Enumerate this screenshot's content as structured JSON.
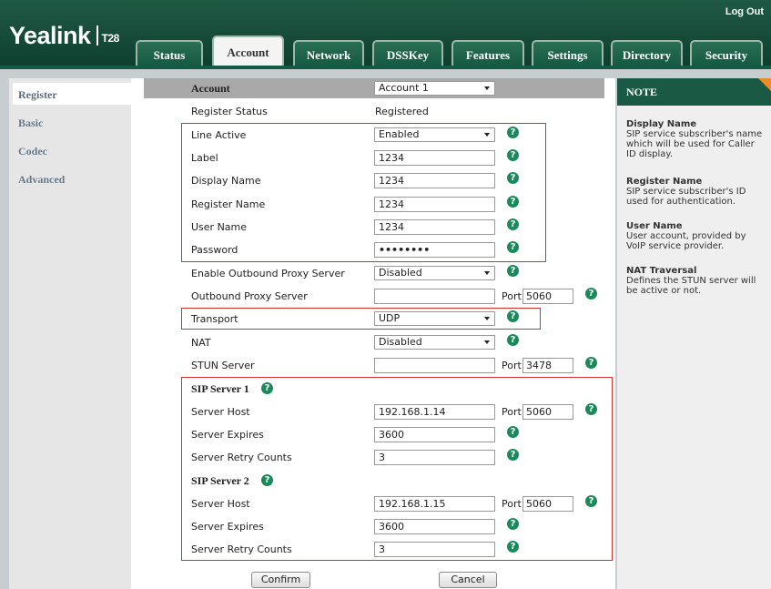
{
  "header": {
    "brand": "Yealink",
    "model": "T28",
    "logout": "Log Out",
    "tabs": [
      "Status",
      "Account",
      "Network",
      "DSSKey",
      "Features",
      "Settings",
      "Directory",
      "Security"
    ],
    "active_tab": "Account"
  },
  "sidebar": {
    "items": [
      "Register",
      "Basic",
      "Codec",
      "Advanced"
    ],
    "selected": "Register"
  },
  "form": {
    "account_label": "Account",
    "account_value": "Account 1",
    "register_status_label": "Register Status",
    "register_status_value": "Registered",
    "line_active_label": "Line Active",
    "line_active_value": "Enabled",
    "label_label": "Label",
    "label_value": "1234",
    "display_name_label": "Display Name",
    "display_name_value": "1234",
    "register_name_label": "Register Name",
    "register_name_value": "1234",
    "user_name_label": "User Name",
    "user_name_value": "1234",
    "password_label": "Password",
    "password_value": "••••••••",
    "outbound_enable_label": "Enable Outbound Proxy Server",
    "outbound_enable_value": "Disabled",
    "outbound_server_label": "Outbound Proxy Server",
    "outbound_server_value": "",
    "outbound_port": "5060",
    "transport_label": "Transport",
    "transport_value": "UDP",
    "nat_label": "NAT",
    "nat_value": "Disabled",
    "stun_label": "STUN Server",
    "stun_value": "",
    "stun_port": "3478",
    "port_label": "Port",
    "sip1": {
      "title": "SIP Server 1",
      "host_label": "Server Host",
      "host": "192.168.1.14",
      "port": "5060",
      "expires_label": "Server Expires",
      "expires": "3600",
      "retry_label": "Server Retry Counts",
      "retry": "3"
    },
    "sip2": {
      "title": "SIP Server 2",
      "host_label": "Server Host",
      "host": "192.168.1.15",
      "port": "5060",
      "expires_label": "Server Expires",
      "expires": "3600",
      "retry_label": "Server Retry Counts",
      "retry": "3"
    },
    "confirm": "Confirm",
    "cancel": "Cancel"
  },
  "note": {
    "title": "NOTE",
    "entries": [
      {
        "heading": "Display Name",
        "text": "SIP service subscriber's name which will be used for Caller ID display."
      },
      {
        "heading": "Register Name",
        "text": "SIP service subscriber's ID used for authentication."
      },
      {
        "heading": "User Name",
        "text": "User account, provided by VoIP service provider."
      },
      {
        "heading": "NAT Traversal",
        "text": "Defines the STUN server will be active or not."
      }
    ]
  },
  "colors": {
    "brand_green": "#1a5a44",
    "help_icon": "#1b8a5a",
    "highlight_box": "#d9302a",
    "note_corner": "#f08a24"
  }
}
